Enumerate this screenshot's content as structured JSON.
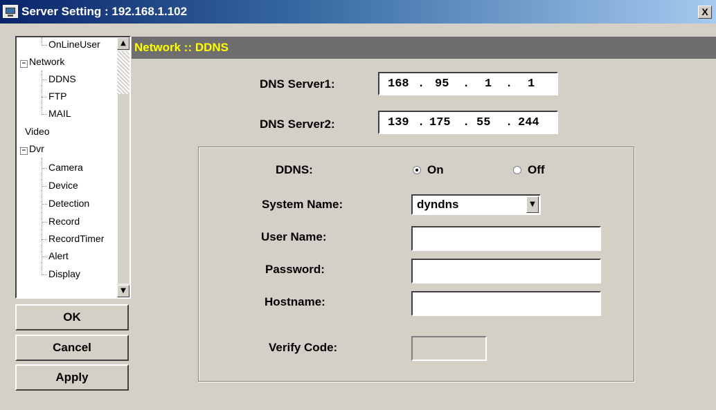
{
  "window": {
    "title": "Server Setting : 192.168.1.102",
    "close_glyph": "X"
  },
  "tree": {
    "items": [
      {
        "label": "OnLineUser"
      },
      {
        "label": "Network",
        "expander": "−"
      },
      {
        "label": "DDNS"
      },
      {
        "label": "FTP"
      },
      {
        "label": "MAIL"
      },
      {
        "label": "Video"
      },
      {
        "label": "Dvr",
        "expander": "−"
      },
      {
        "label": "Camera"
      },
      {
        "label": "Device"
      },
      {
        "label": "Detection"
      },
      {
        "label": "Record"
      },
      {
        "label": "RecordTimer"
      },
      {
        "label": "Alert"
      },
      {
        "label": "Display"
      }
    ],
    "scroll_up_glyph": "▲",
    "scroll_down_glyph": "▼"
  },
  "buttons": {
    "ok": "OK",
    "cancel": "Cancel",
    "apply": "Apply"
  },
  "header": {
    "title": "Network :: DDNS",
    "color": "#ffff00"
  },
  "dns": {
    "server1_label": "DNS Server1:",
    "server1": [
      "168",
      "95",
      "1",
      "1"
    ],
    "server2_label": "DNS Server2:",
    "server2": [
      "139",
      "175",
      "55",
      "244"
    ],
    "dot": "."
  },
  "ddns": {
    "label": "DDNS:",
    "on_label": "On",
    "off_label": "Off",
    "selected": "On",
    "system_name_label": "System Name:",
    "system_name_value": "dyndns",
    "dropdown_glyph": "▼",
    "user_name_label": "User Name:",
    "user_name_value": "",
    "password_label": "Password:",
    "password_value": "",
    "hostname_label": "Hostname:",
    "hostname_value": "",
    "verify_code_label": "Verify Code:",
    "verify_code_value": ""
  }
}
